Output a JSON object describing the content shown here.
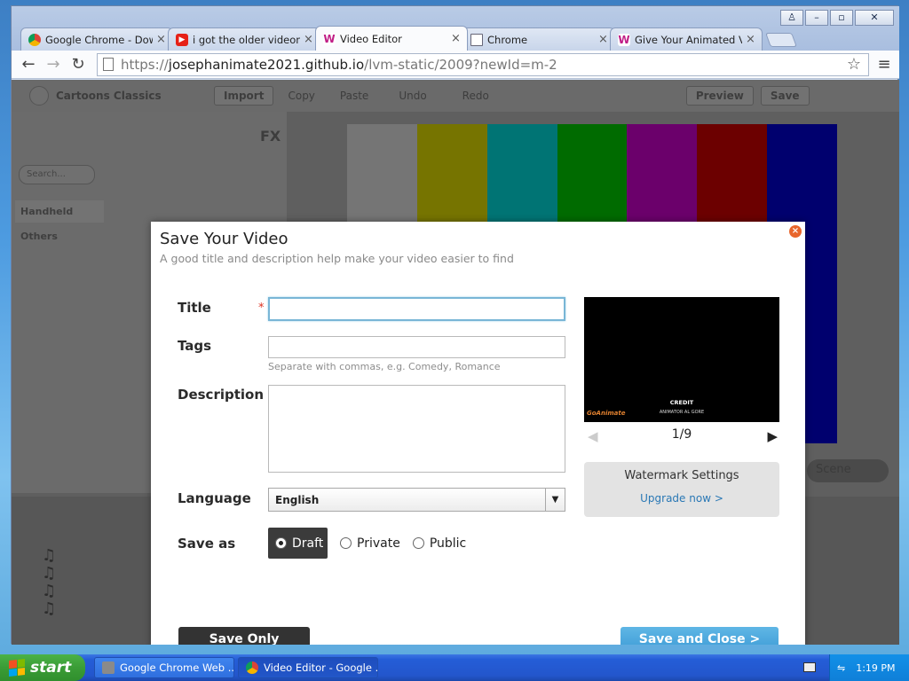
{
  "browser": {
    "tabs": [
      {
        "label": "Google Chrome - Downlo",
        "icon": "chrome-icon",
        "active": false
      },
      {
        "label": "i got the older videom",
        "icon": "youtube-icon",
        "active": false
      },
      {
        "label": "Video Editor",
        "icon": "wrapper-icon",
        "active": true
      },
      {
        "label": "Chrome",
        "icon": "page-icon",
        "active": false
      },
      {
        "label": "Give Your Animated Vide",
        "icon": "wrapper-icon",
        "active": false
      }
    ],
    "tab_close_glyph": "×",
    "url_scheme": "https://",
    "url_host": "josephanimate2021.github.io",
    "url_path": "/lvm-static/2009?newId=m-2"
  },
  "editor_bg": {
    "theme": "Cartoons Classics",
    "import": "Import",
    "copy": "Copy",
    "paste": "Paste",
    "undo": "Undo",
    "redo": "Redo",
    "preview": "Preview",
    "save": "Save",
    "search_placeholder": "Search...",
    "categories": [
      "Handheld",
      "Others"
    ],
    "tab_fx": "FX",
    "scene": "Scene",
    "stage_colors": [
      "#c3c3c3",
      "#c4c100",
      "#00c1c1",
      "#00b300",
      "#b300b3",
      "#b40000",
      "#0000b8"
    ]
  },
  "modal": {
    "title": "Save Your Video",
    "subtitle": "A good title and description help make your video easier to find",
    "close_glyph": "×",
    "title_label": "Title",
    "required_mark": "*",
    "title_value": "",
    "tags_label": "Tags",
    "tags_value": "",
    "tags_hint": "Separate with commas, e.g. Comedy, Romance",
    "description_label": "Description",
    "description_value": "",
    "language_label": "Language",
    "language_value": "English",
    "save_as_label": "Save as",
    "save_as_options": [
      {
        "label": "Draft",
        "selected": true
      },
      {
        "label": "Private",
        "selected": false
      },
      {
        "label": "Public",
        "selected": false
      }
    ],
    "preview": {
      "credit_title": "CREDIT",
      "credit_line": "ANIMATOR     AL GORE",
      "brand": "GoAnimate",
      "page_indicator": "1/9"
    },
    "watermark_title": "Watermark Settings",
    "upgrade_link": "Upgrade now >",
    "save_only": "Save Only",
    "save_and_close": "Save and Close >"
  },
  "taskbar": {
    "start": "start",
    "tasks": [
      {
        "label": "Google Chrome Web ...",
        "active": false
      },
      {
        "label": "Video Editor - Google ...",
        "active": true
      }
    ],
    "clock": "1:19 PM"
  }
}
